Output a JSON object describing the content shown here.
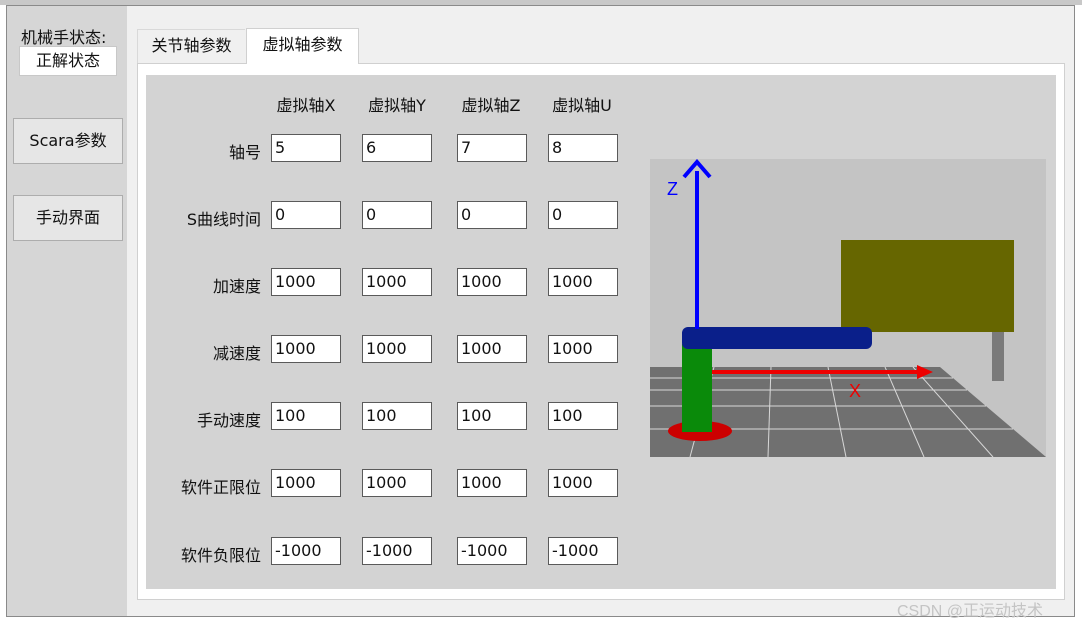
{
  "sidebar": {
    "status_label": "机械手状态:",
    "status_value": "正解状态",
    "scara_button": "Scara参数",
    "manual_button": "手动界面"
  },
  "tabs": [
    {
      "label": "关节轴参数",
      "active": false
    },
    {
      "label": "虚拟轴参数",
      "active": true
    }
  ],
  "table": {
    "columns": [
      "虚拟轴X",
      "虚拟轴Y",
      "虚拟轴Z",
      "虚拟轴U"
    ],
    "rows": [
      {
        "label": "轴号",
        "values": [
          "5",
          "6",
          "7",
          "8"
        ]
      },
      {
        "label": "S曲线时间",
        "values": [
          "0",
          "0",
          "0",
          "0"
        ]
      },
      {
        "label": "加速度",
        "values": [
          "1000",
          "1000",
          "1000",
          "1000"
        ]
      },
      {
        "label": "减速度",
        "values": [
          "1000",
          "1000",
          "1000",
          "1000"
        ]
      },
      {
        "label": "手动速度",
        "values": [
          "100",
          "100",
          "100",
          "100"
        ]
      },
      {
        "label": "软件正限位",
        "values": [
          "1000",
          "1000",
          "1000",
          "1000"
        ]
      },
      {
        "label": "软件负限位",
        "values": [
          "-1000",
          "-1000",
          "-1000",
          "-1000"
        ]
      }
    ]
  },
  "viewport": {
    "axis_z_label": "Z",
    "axis_x_label": "X",
    "colors": {
      "z_axis": "#0000ff",
      "x_axis": "#ee0000",
      "arm": "#0a1f8a",
      "column": "#0a8a0a",
      "base": "#cc0000",
      "block": "#666600"
    }
  },
  "watermark": "CSDN @正运动技术"
}
